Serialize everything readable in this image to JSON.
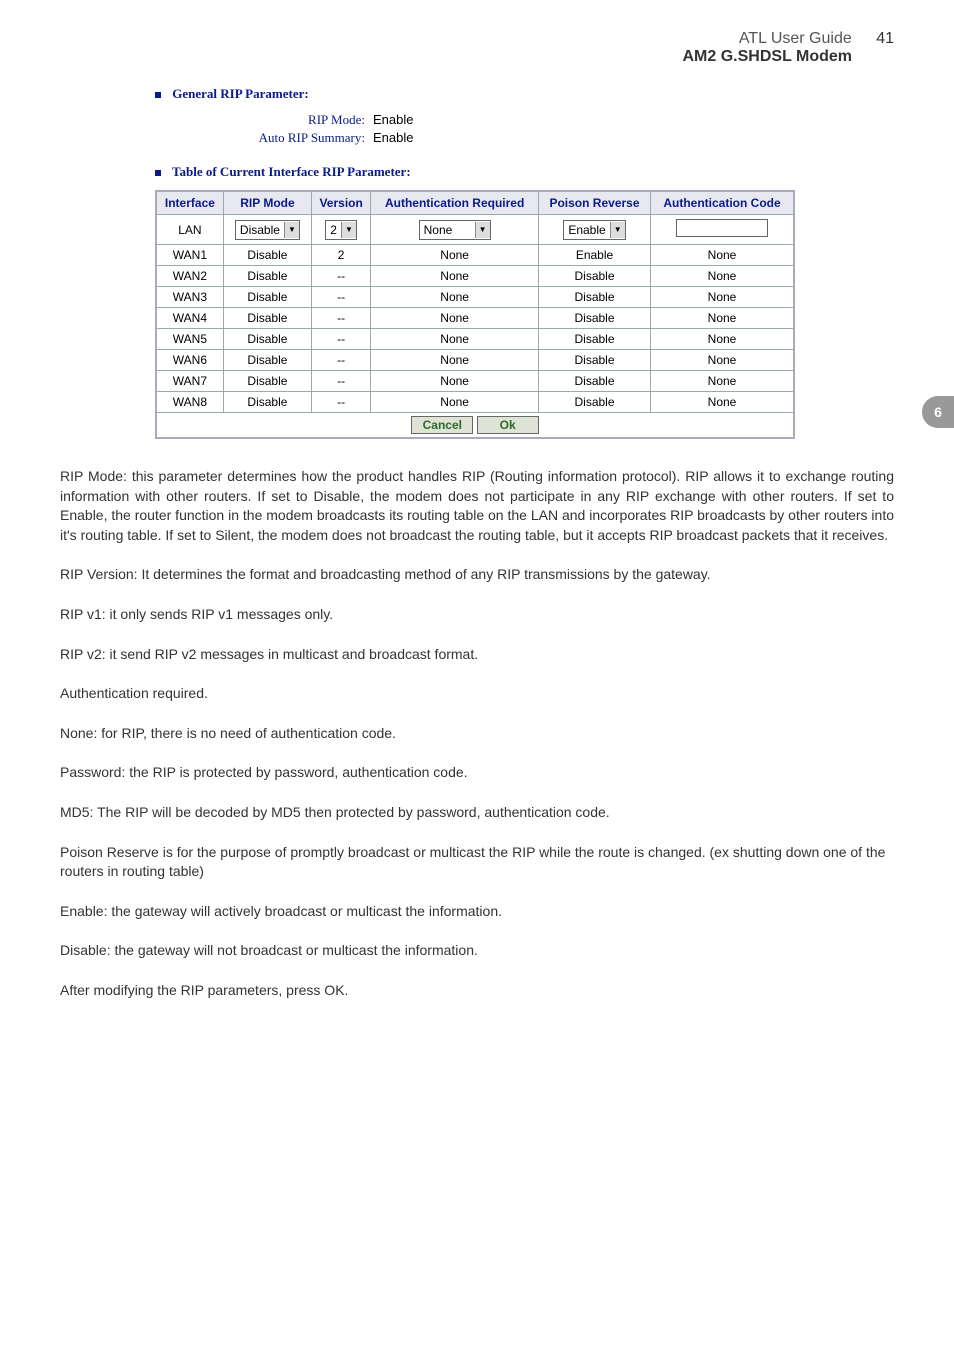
{
  "header": {
    "guide": "ATL User Guide",
    "pagenum": "41",
    "product": "AM2 G.SHDSL Modem"
  },
  "chapter_tab": "6",
  "section1": {
    "title": "General RIP Parameter:",
    "rip_mode_label": "RIP Mode:",
    "rip_mode_value": "Enable",
    "auto_summary_label": "Auto RIP Summary:",
    "auto_summary_value": "Enable"
  },
  "section2": {
    "title": "Table of Current Interface RIP Parameter:"
  },
  "table": {
    "headers": {
      "interface": "Interface",
      "rip_mode": "RIP Mode",
      "version": "Version",
      "auth_req": "Authentication Required",
      "poison": "Poison Reverse",
      "auth_code": "Authentication Code"
    },
    "input_row": {
      "interface": "LAN",
      "rip_mode": "Disable",
      "version": "2",
      "auth_req": "None",
      "poison": "Enable",
      "auth_code": ""
    },
    "rows": [
      {
        "interface": "WAN1",
        "rip_mode": "Disable",
        "version": "2",
        "auth_req": "None",
        "poison": "Enable",
        "auth_code": "None"
      },
      {
        "interface": "WAN2",
        "rip_mode": "Disable",
        "version": "--",
        "auth_req": "None",
        "poison": "Disable",
        "auth_code": "None"
      },
      {
        "interface": "WAN3",
        "rip_mode": "Disable",
        "version": "--",
        "auth_req": "None",
        "poison": "Disable",
        "auth_code": "None"
      },
      {
        "interface": "WAN4",
        "rip_mode": "Disable",
        "version": "--",
        "auth_req": "None",
        "poison": "Disable",
        "auth_code": "None"
      },
      {
        "interface": "WAN5",
        "rip_mode": "Disable",
        "version": "--",
        "auth_req": "None",
        "poison": "Disable",
        "auth_code": "None"
      },
      {
        "interface": "WAN6",
        "rip_mode": "Disable",
        "version": "--",
        "auth_req": "None",
        "poison": "Disable",
        "auth_code": "None"
      },
      {
        "interface": "WAN7",
        "rip_mode": "Disable",
        "version": "--",
        "auth_req": "None",
        "poison": "Disable",
        "auth_code": "None"
      },
      {
        "interface": "WAN8",
        "rip_mode": "Disable",
        "version": "--",
        "auth_req": "None",
        "poison": "Disable",
        "auth_code": "None"
      }
    ],
    "buttons": {
      "cancel": "Cancel",
      "ok": "Ok"
    }
  },
  "body": {
    "p1": "RIP Mode: this parameter determines how the product handles RIP (Routing information protocol). RIP allows it to exchange routing information with other routers. If set to Disable, the modem does not participate in any RIP exchange with other routers. If set to Enable, the router function in the modem broadcasts its routing table on the LAN and incorporates RIP broadcasts by other routers into it's routing table. If set to Silent, the modem does not broadcast the routing table, but it accepts RIP broadcast packets that it receives.",
    "p2": "RIP Version: It determines the format and broadcasting method of any RIP transmissions by the gateway.",
    "p3": "RIP v1: it only sends RIP v1 messages only.",
    "p4": "RIP v2: it send RIP v2 messages in multicast and broadcast format.",
    "p5": "Authentication required.",
    "p6": "None: for RIP, there is no need of authentication code.",
    "p7": "Password: the RIP is protected by password, authentication code.",
    "p8": "MD5: The RIP will be decoded by MD5 then protected by password, authentication code.",
    "p9": "Poison Reserve is for the purpose of promptly broadcast or multicast the RIP while the route is changed. (ex shutting down one of the routers in routing table)",
    "p10": "Enable: the gateway will actively broadcast or multicast the information.",
    "p11": "Disable: the gateway will not broadcast or multicast the information.",
    "p12": "After modifying the RIP parameters, press OK."
  }
}
